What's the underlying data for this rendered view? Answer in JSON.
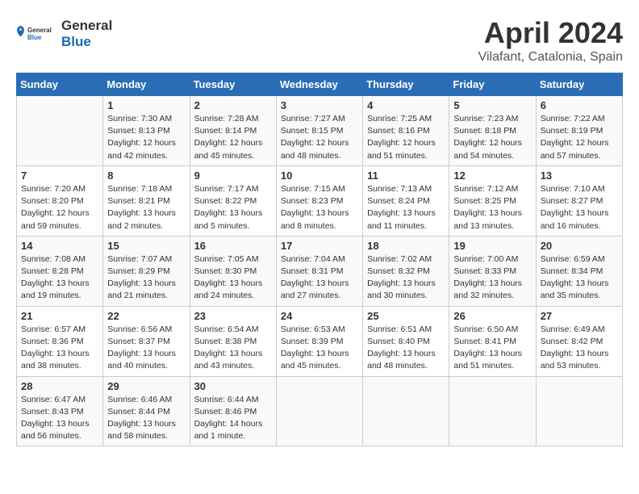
{
  "header": {
    "logo_general": "General",
    "logo_blue": "Blue",
    "title": "April 2024",
    "subtitle": "Vilafant, Catalonia, Spain"
  },
  "days_of_week": [
    "Sunday",
    "Monday",
    "Tuesday",
    "Wednesday",
    "Thursday",
    "Friday",
    "Saturday"
  ],
  "weeks": [
    [
      {
        "day": "",
        "content": ""
      },
      {
        "day": "1",
        "content": "Sunrise: 7:30 AM\nSunset: 8:13 PM\nDaylight: 12 hours\nand 42 minutes."
      },
      {
        "day": "2",
        "content": "Sunrise: 7:28 AM\nSunset: 8:14 PM\nDaylight: 12 hours\nand 45 minutes."
      },
      {
        "day": "3",
        "content": "Sunrise: 7:27 AM\nSunset: 8:15 PM\nDaylight: 12 hours\nand 48 minutes."
      },
      {
        "day": "4",
        "content": "Sunrise: 7:25 AM\nSunset: 8:16 PM\nDaylight: 12 hours\nand 51 minutes."
      },
      {
        "day": "5",
        "content": "Sunrise: 7:23 AM\nSunset: 8:18 PM\nDaylight: 12 hours\nand 54 minutes."
      },
      {
        "day": "6",
        "content": "Sunrise: 7:22 AM\nSunset: 8:19 PM\nDaylight: 12 hours\nand 57 minutes."
      }
    ],
    [
      {
        "day": "7",
        "content": "Sunrise: 7:20 AM\nSunset: 8:20 PM\nDaylight: 12 hours\nand 59 minutes."
      },
      {
        "day": "8",
        "content": "Sunrise: 7:18 AM\nSunset: 8:21 PM\nDaylight: 13 hours\nand 2 minutes."
      },
      {
        "day": "9",
        "content": "Sunrise: 7:17 AM\nSunset: 8:22 PM\nDaylight: 13 hours\nand 5 minutes."
      },
      {
        "day": "10",
        "content": "Sunrise: 7:15 AM\nSunset: 8:23 PM\nDaylight: 13 hours\nand 8 minutes."
      },
      {
        "day": "11",
        "content": "Sunrise: 7:13 AM\nSunset: 8:24 PM\nDaylight: 13 hours\nand 11 minutes."
      },
      {
        "day": "12",
        "content": "Sunrise: 7:12 AM\nSunset: 8:25 PM\nDaylight: 13 hours\nand 13 minutes."
      },
      {
        "day": "13",
        "content": "Sunrise: 7:10 AM\nSunset: 8:27 PM\nDaylight: 13 hours\nand 16 minutes."
      }
    ],
    [
      {
        "day": "14",
        "content": "Sunrise: 7:08 AM\nSunset: 8:28 PM\nDaylight: 13 hours\nand 19 minutes."
      },
      {
        "day": "15",
        "content": "Sunrise: 7:07 AM\nSunset: 8:29 PM\nDaylight: 13 hours\nand 21 minutes."
      },
      {
        "day": "16",
        "content": "Sunrise: 7:05 AM\nSunset: 8:30 PM\nDaylight: 13 hours\nand 24 minutes."
      },
      {
        "day": "17",
        "content": "Sunrise: 7:04 AM\nSunset: 8:31 PM\nDaylight: 13 hours\nand 27 minutes."
      },
      {
        "day": "18",
        "content": "Sunrise: 7:02 AM\nSunset: 8:32 PM\nDaylight: 13 hours\nand 30 minutes."
      },
      {
        "day": "19",
        "content": "Sunrise: 7:00 AM\nSunset: 8:33 PM\nDaylight: 13 hours\nand 32 minutes."
      },
      {
        "day": "20",
        "content": "Sunrise: 6:59 AM\nSunset: 8:34 PM\nDaylight: 13 hours\nand 35 minutes."
      }
    ],
    [
      {
        "day": "21",
        "content": "Sunrise: 6:57 AM\nSunset: 8:36 PM\nDaylight: 13 hours\nand 38 minutes."
      },
      {
        "day": "22",
        "content": "Sunrise: 6:56 AM\nSunset: 8:37 PM\nDaylight: 13 hours\nand 40 minutes."
      },
      {
        "day": "23",
        "content": "Sunrise: 6:54 AM\nSunset: 8:38 PM\nDaylight: 13 hours\nand 43 minutes."
      },
      {
        "day": "24",
        "content": "Sunrise: 6:53 AM\nSunset: 8:39 PM\nDaylight: 13 hours\nand 45 minutes."
      },
      {
        "day": "25",
        "content": "Sunrise: 6:51 AM\nSunset: 8:40 PM\nDaylight: 13 hours\nand 48 minutes."
      },
      {
        "day": "26",
        "content": "Sunrise: 6:50 AM\nSunset: 8:41 PM\nDaylight: 13 hours\nand 51 minutes."
      },
      {
        "day": "27",
        "content": "Sunrise: 6:49 AM\nSunset: 8:42 PM\nDaylight: 13 hours\nand 53 minutes."
      }
    ],
    [
      {
        "day": "28",
        "content": "Sunrise: 6:47 AM\nSunset: 8:43 PM\nDaylight: 13 hours\nand 56 minutes."
      },
      {
        "day": "29",
        "content": "Sunrise: 6:46 AM\nSunset: 8:44 PM\nDaylight: 13 hours\nand 58 minutes."
      },
      {
        "day": "30",
        "content": "Sunrise: 6:44 AM\nSunset: 8:46 PM\nDaylight: 14 hours\nand 1 minute."
      },
      {
        "day": "",
        "content": ""
      },
      {
        "day": "",
        "content": ""
      },
      {
        "day": "",
        "content": ""
      },
      {
        "day": "",
        "content": ""
      }
    ]
  ]
}
